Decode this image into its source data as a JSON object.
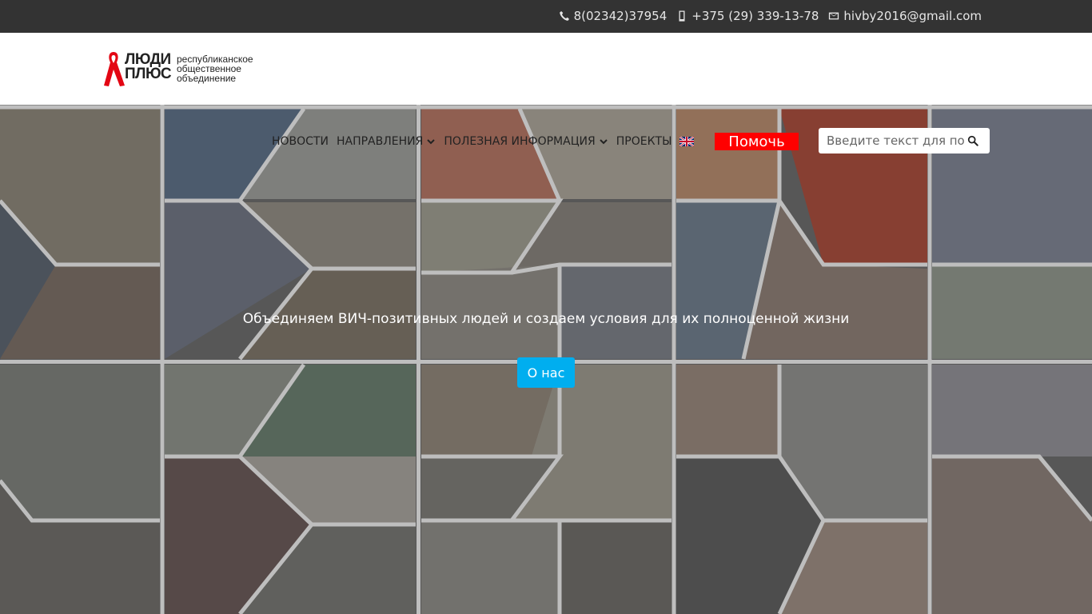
{
  "topbar": {
    "phone1": "8(02342)37954",
    "phone2": "+375 (29) 339-13-78",
    "email": "hivby2016@gmail.com",
    "phone1_icon": "phone-icon",
    "phone2_icon": "mobile-icon",
    "email_icon": "envelope-icon"
  },
  "logo": {
    "line1": "ЛЮДИ",
    "line2": "ПЛЮС",
    "subtitle_1": "республиканское",
    "subtitle_2": "общественное",
    "subtitle_3": "объединение",
    "ribbon_color": "#e30613"
  },
  "nav": {
    "items": [
      {
        "label": "НОВОСТИ",
        "has_dropdown": false
      },
      {
        "label": "НАПРАВЛЕНИЯ",
        "has_dropdown": true
      },
      {
        "label": "ПОЛЕЗНАЯ ИНФОРМАЦИЯ",
        "has_dropdown": true
      },
      {
        "label": "ПРОЕКТЫ",
        "has_dropdown": false
      }
    ],
    "language_flag": "uk-flag-icon",
    "help_button": "Помочь",
    "help_color": "#ff0000"
  },
  "search": {
    "placeholder": "Введите текст для поиска",
    "icon": "search-icon"
  },
  "hero": {
    "tagline": "Объединяем ВИЧ-позитивных людей и создаем условия для их полноценной жизни",
    "about_button": "О нас",
    "button_color": "#00aeef"
  },
  "colors": {
    "topbar_bg": "#333333",
    "header_bg": "#ffffff"
  }
}
